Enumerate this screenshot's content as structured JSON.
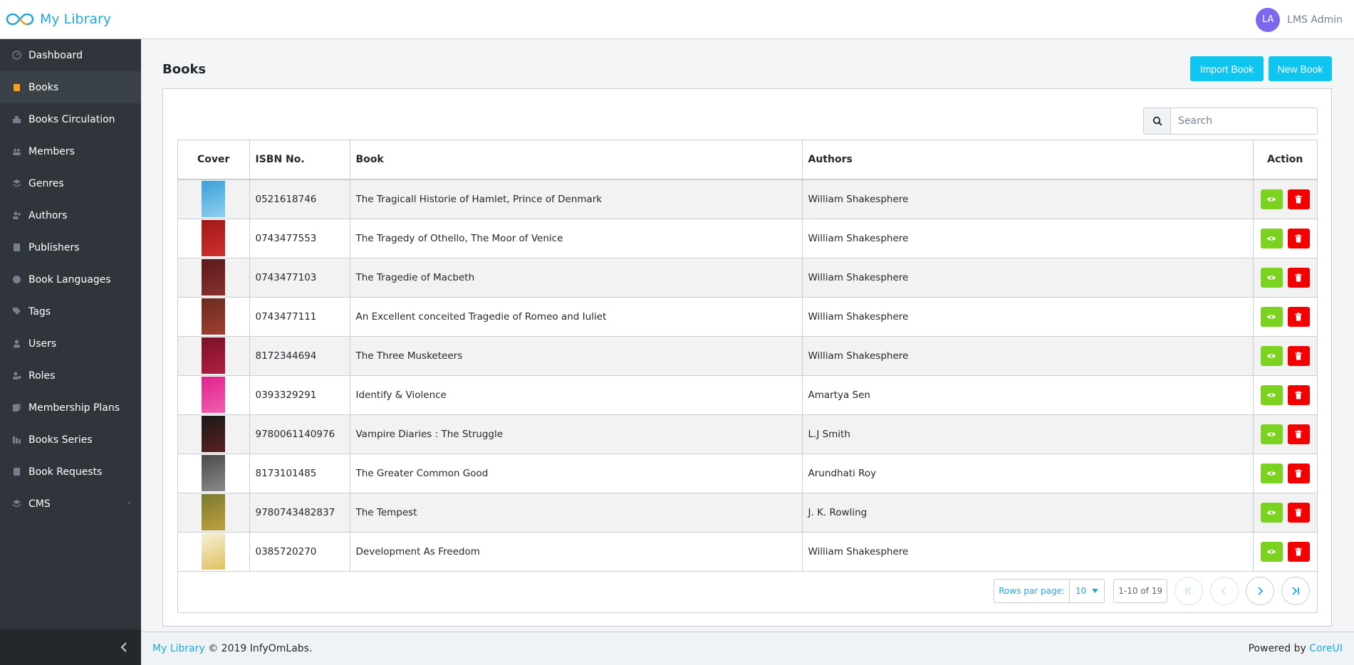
{
  "header": {
    "brand": "My Library",
    "user_initials": "LA",
    "user_name": "LMS Admin"
  },
  "sidebar": {
    "items": [
      {
        "label": "Dashboard",
        "icon": "speedometer-icon"
      },
      {
        "label": "Books",
        "icon": "book-icon",
        "active": true
      },
      {
        "label": "Books Circulation",
        "icon": "circulation-icon"
      },
      {
        "label": "Members",
        "icon": "members-icon"
      },
      {
        "label": "Genres",
        "icon": "layers-icon"
      },
      {
        "label": "Authors",
        "icon": "authors-icon"
      },
      {
        "label": "Publishers",
        "icon": "publisher-icon"
      },
      {
        "label": "Book Languages",
        "icon": "globe-icon"
      },
      {
        "label": "Tags",
        "icon": "tags-icon"
      },
      {
        "label": "Users",
        "icon": "user-icon"
      },
      {
        "label": "Roles",
        "icon": "roles-icon"
      },
      {
        "label": "Membership Plans",
        "icon": "plans-icon"
      },
      {
        "label": "Books Series",
        "icon": "series-icon"
      },
      {
        "label": "Book Requests",
        "icon": "request-icon"
      },
      {
        "label": "CMS",
        "icon": "cms-icon"
      }
    ]
  },
  "page": {
    "title": "Books",
    "import_label": "Import Book",
    "new_label": "New Book",
    "search_placeholder": "Search"
  },
  "table": {
    "headers": {
      "cover": "Cover",
      "isbn": "ISBN No.",
      "book": "Book",
      "authors": "Authors",
      "action": "Action"
    },
    "rows": [
      {
        "isbn": "0521618746",
        "book": "The Tragicall Historie of Hamlet, Prince of Denmark",
        "author": "William Shakesphere"
      },
      {
        "isbn": "0743477553",
        "book": "The Tragedy of Othello, The Moor of Venice",
        "author": "William Shakesphere"
      },
      {
        "isbn": "0743477103",
        "book": "The Tragedie of Macbeth",
        "author": "William Shakesphere"
      },
      {
        "isbn": "0743477111",
        "book": "An Excellent conceited Tragedie of Romeo and Iuliet",
        "author": "William Shakesphere"
      },
      {
        "isbn": "8172344694",
        "book": "The Three Musketeers",
        "author": "William Shakesphere"
      },
      {
        "isbn": "0393329291",
        "book": "Identify & Violence",
        "author": "Amartya Sen"
      },
      {
        "isbn": "9780061140976",
        "book": "Vampire Diaries : The Struggle",
        "author": "L.J Smith"
      },
      {
        "isbn": "8173101485",
        "book": "The Greater Common Good",
        "author": "Arundhati Roy"
      },
      {
        "isbn": "9780743482837",
        "book": "The Tempest",
        "author": "J. K. Rowling"
      },
      {
        "isbn": "0385720270",
        "book": "Development As Freedom",
        "author": "William Shakesphere"
      }
    ]
  },
  "pagination": {
    "rows_label": "Rows par page:",
    "rows_value": "10",
    "range": "1-10 of 19"
  },
  "footer": {
    "brand_link": "My Library",
    "copyright": "© 2019 InfyOmLabs.",
    "powered_by": "Powered by",
    "coreui": "CoreUI"
  },
  "colors": {
    "accent": "#0ec6ef",
    "view": "#7bd320",
    "delete": "#f40000",
    "sidebar": "#2f353a",
    "link": "#20a8d8"
  }
}
